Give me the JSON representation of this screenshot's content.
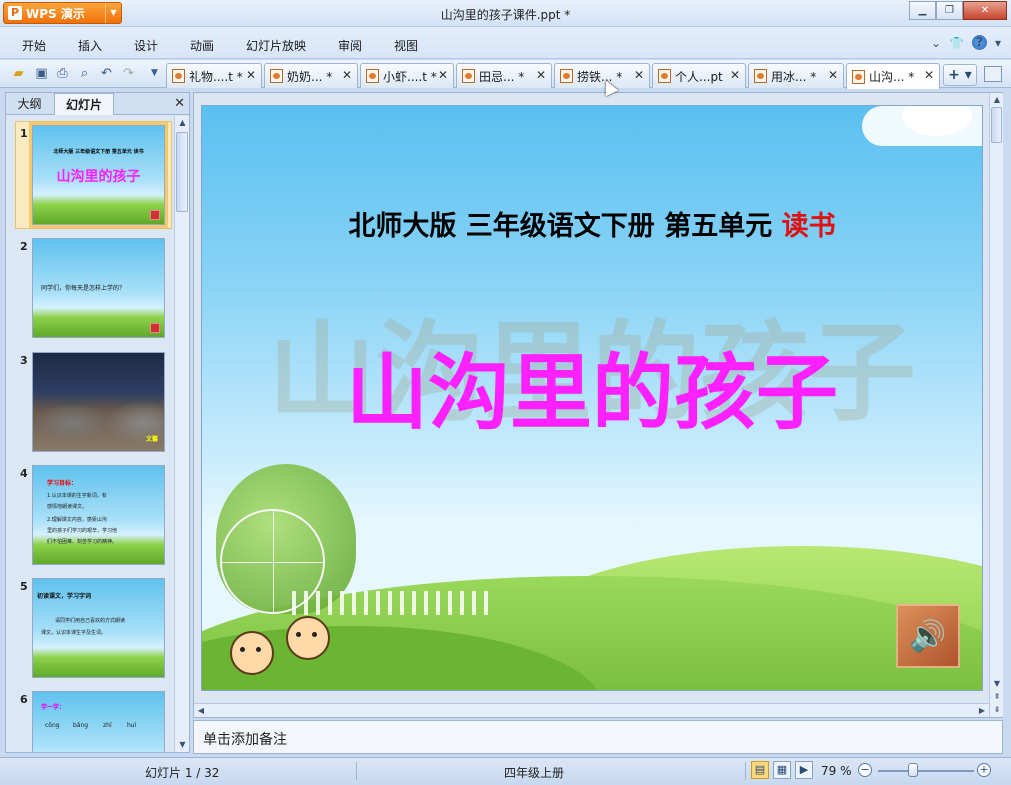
{
  "app": {
    "name": "WPS 演示",
    "window_title": "山沟里的孩子课件.ppt *"
  },
  "menu": [
    "开始",
    "插入",
    "设计",
    "动画",
    "幻灯片放映",
    "审阅",
    "视图"
  ],
  "toolbar_icons": [
    "open-icon",
    "save-icon",
    "print-icon",
    "print-preview-icon",
    "undo-icon",
    "redo-icon",
    "customize-icon"
  ],
  "tabs": [
    {
      "label": "礼物....t *"
    },
    {
      "label": "奶奶... *"
    },
    {
      "label": "小虾....t *"
    },
    {
      "label": "田忌... *"
    },
    {
      "label": "捞铁... *"
    },
    {
      "label": "个人...pt"
    },
    {
      "label": "用冰... *"
    },
    {
      "label": "山沟... *"
    }
  ],
  "left_panel": {
    "tabs": [
      "大纲",
      "幻灯片"
    ],
    "close": "✕"
  },
  "thumbnails": [
    {
      "num": "1",
      "sub": "北师大版 三年级语文下册 第五单元 读书",
      "title": "山沟里的孩子"
    },
    {
      "num": "2",
      "text": "同学们，你每天是怎样上学的？"
    },
    {
      "num": "3",
      "caption": "文馨"
    },
    {
      "num": "4",
      "heading": "学习目标：",
      "lines": [
        "1.认识本课的生字新词，有",
        "感情地朗读课文。",
        "2.理解课文内容，感受山沟",
        "里的孩子们学习的艰辛，学习他",
        "们不怕困难、刻苦学习的精神。"
      ]
    },
    {
      "num": "5",
      "heading": "初读课文，学习字词",
      "lines": [
        "请同学们用自己喜欢的方式朗读",
        "课文，认识本课生字及生词。"
      ]
    },
    {
      "num": "6",
      "heading": "学一学：",
      "pinyin": [
        "cōng",
        "bǎng",
        "zhī",
        "huì"
      ]
    }
  ],
  "slide": {
    "subtitle_main": "北师大版  三年级语文下册  第五单元",
    "subtitle_red": "读书",
    "title": "山沟里的孩子",
    "title_shadow": "山沟里的孩子",
    "speaker_icon": "speaker-icon"
  },
  "notes": {
    "placeholder": "单击添加备注"
  },
  "status": {
    "slide_counter": "幻灯片 1 / 32",
    "template_name": "四年级上册",
    "zoom": "79 %"
  },
  "colors": {
    "accent_orange": "#f0710a",
    "title_magenta": "#ff20ff",
    "subtitle_red": "#e01010"
  }
}
